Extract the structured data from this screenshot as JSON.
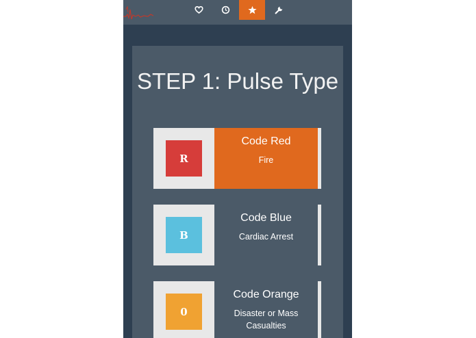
{
  "topbar": {
    "logo_icon": "heartbeat-logo-icon",
    "nav": [
      {
        "icon": "heart-icon",
        "active": false
      },
      {
        "icon": "clock-icon",
        "active": false
      },
      {
        "icon": "star-icon",
        "active": true
      },
      {
        "icon": "wrench-icon",
        "active": false
      }
    ]
  },
  "main": {
    "title": "STEP 1: Pulse Type",
    "codes": [
      {
        "letter": "R",
        "name": "Code Red",
        "description": "Fire",
        "color": "#d63d3a",
        "selected": true
      },
      {
        "letter": "B",
        "name": "Code Blue",
        "description": "Cardiac Arrest",
        "color": "#5bc0de",
        "selected": false
      },
      {
        "letter": "0",
        "name": "Code Orange",
        "description": "Disaster or Mass Casualties",
        "color": "#f0a232",
        "selected": false
      }
    ]
  },
  "colors": {
    "accent": "#e0691e",
    "background": "#2e3f51",
    "panel": "#4b5a68",
    "logo": "#c0392b"
  }
}
